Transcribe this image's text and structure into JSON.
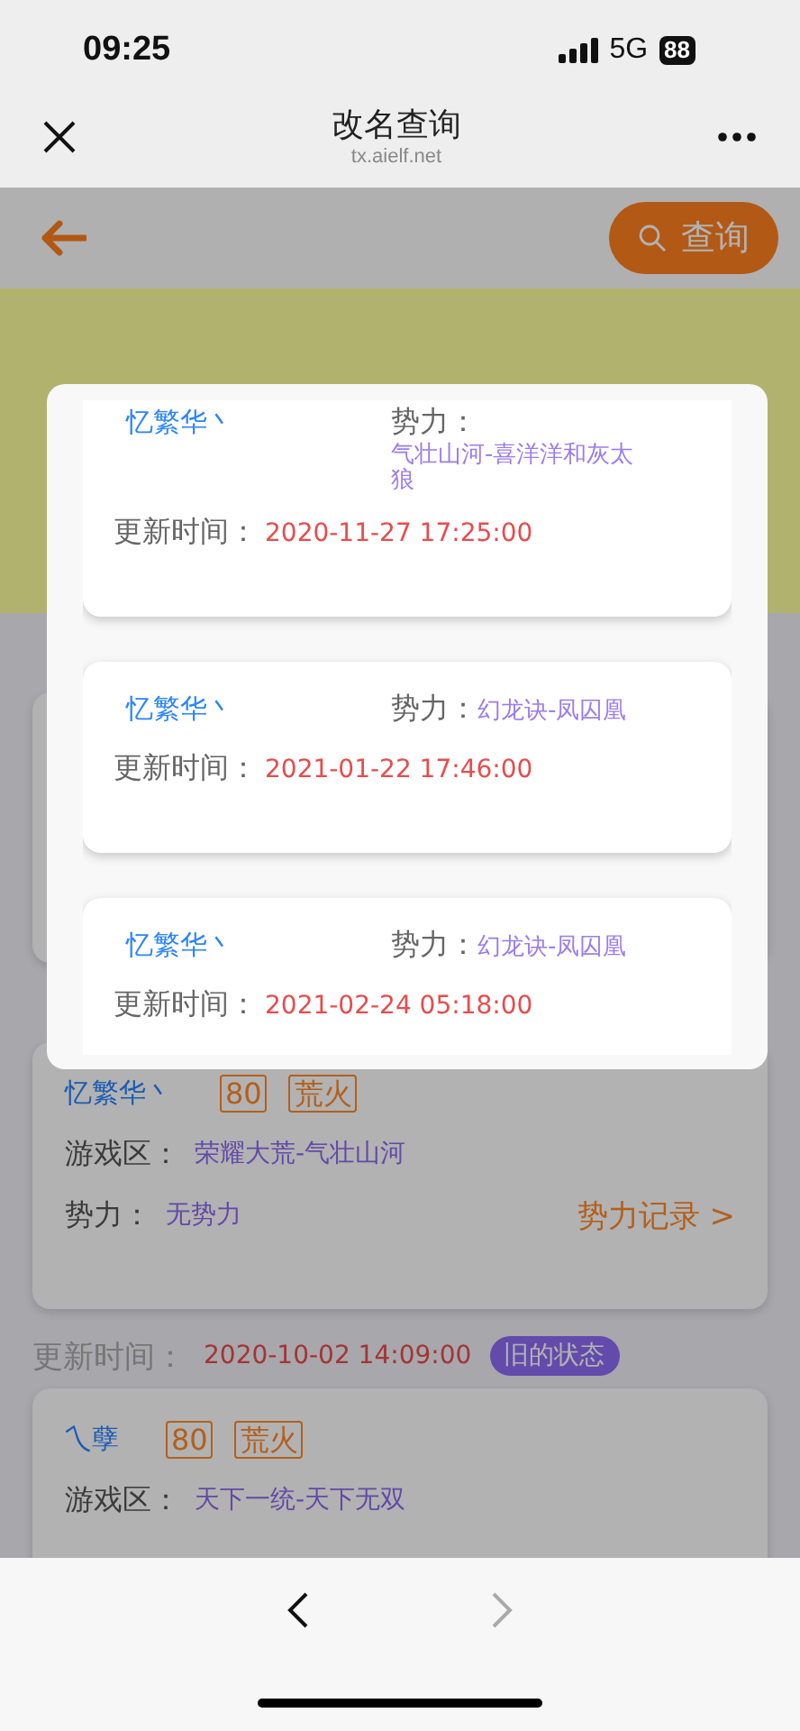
{
  "status_bar": {
    "time": "09:25",
    "network": "5G",
    "battery": "88"
  },
  "browser": {
    "title": "改名查询",
    "url": "tx.aielf.net"
  },
  "app_bar": {
    "search_button": "查询"
  },
  "records": [
    {
      "kind": "covered"
    },
    {
      "kind": "full",
      "card": {
        "name": "忆繁华丶",
        "tags": [
          "80",
          "荒火"
        ],
        "zone_label": "游戏区：",
        "zone": "荣耀大荒-气壮山河",
        "faction_label": "势力：",
        "faction": "无势力",
        "link": "势力记录 >"
      }
    },
    {
      "kind": "full",
      "label": "更新时间：",
      "time": "2020-10-02 14:09:00",
      "badge": "旧的状态",
      "card": {
        "name": "乀孽",
        "tags": [
          "80",
          "荒火"
        ],
        "zone_label": "游戏区：",
        "zone": "天下一统-天下无双"
      }
    }
  ],
  "dialog": {
    "items": [
      {
        "name": "忆繁华丶",
        "faction_label": "势力：",
        "faction": "气壮山河-喜洋洋和灰太狼",
        "time_label": "更新时间：",
        "time": "2020-11-27 17:25:00"
      },
      {
        "name": "忆繁华丶",
        "faction_label": "势力：",
        "faction": "幻龙诀-凤囚凰",
        "time_label": "更新时间：",
        "time": "2021-01-22 17:46:00"
      },
      {
        "name": "忆繁华丶",
        "faction_label": "势力：",
        "faction": "幻龙诀-凤囚凰",
        "time_label": "更新时间：",
        "time": "2021-02-24 05:18:00"
      }
    ]
  },
  "bottom_bar": {
    "back_disabled": false,
    "forward_disabled": true
  }
}
